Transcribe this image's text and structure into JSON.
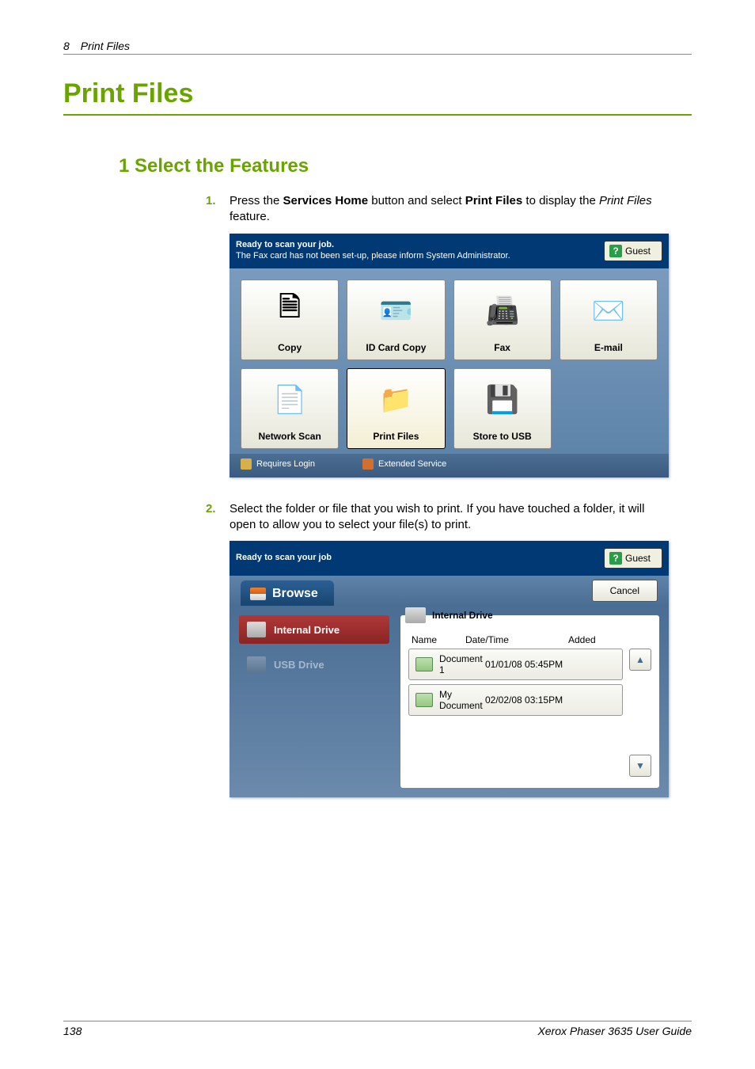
{
  "header": {
    "page": "8",
    "section": "Print Files"
  },
  "title": "Print Files",
  "section_heading": "1 Select the Features",
  "steps": {
    "s1": {
      "num": "1.",
      "pre": "Press the ",
      "b1": "Services Home",
      "mid": " button and select ",
      "b2": "Print Files",
      "post": " to display the ",
      "i1": "Print Files",
      "tail": " feature."
    },
    "s2": {
      "num": "2.",
      "text": "Select the folder or file that you wish to print. If you have touched a folder, it will open to allow you to select your file(s) to print."
    }
  },
  "shot1": {
    "msg_line1": "Ready to scan your job.",
    "msg_line2": "The Fax card has not been set-up, please inform System Administrator.",
    "guest": "Guest",
    "tiles": {
      "copy": "Copy",
      "idcard": "ID Card Copy",
      "fax": "Fax",
      "email": "E-mail",
      "netscan": "Network Scan",
      "printfiles": "Print Files",
      "storeusb": "Store to USB"
    },
    "foot_login": "Requires Login",
    "foot_ext": "Extended Service"
  },
  "shot2": {
    "header_msg": "Ready to scan your job",
    "guest": "Guest",
    "tab_browse": "Browse",
    "cancel": "Cancel",
    "drives": {
      "internal": "Internal Drive",
      "usb": "USB Drive"
    },
    "panel_drive": "Internal Drive",
    "cols": {
      "name": "Name",
      "dt": "Date/Time",
      "added": "Added"
    },
    "files": [
      {
        "name": "Document 1",
        "dt": "01/01/08 05:45PM"
      },
      {
        "name": "My Document",
        "dt": "02/02/08 03:15PM"
      }
    ]
  },
  "footer": {
    "page": "138",
    "doc": "Xerox Phaser 3635 User Guide"
  }
}
